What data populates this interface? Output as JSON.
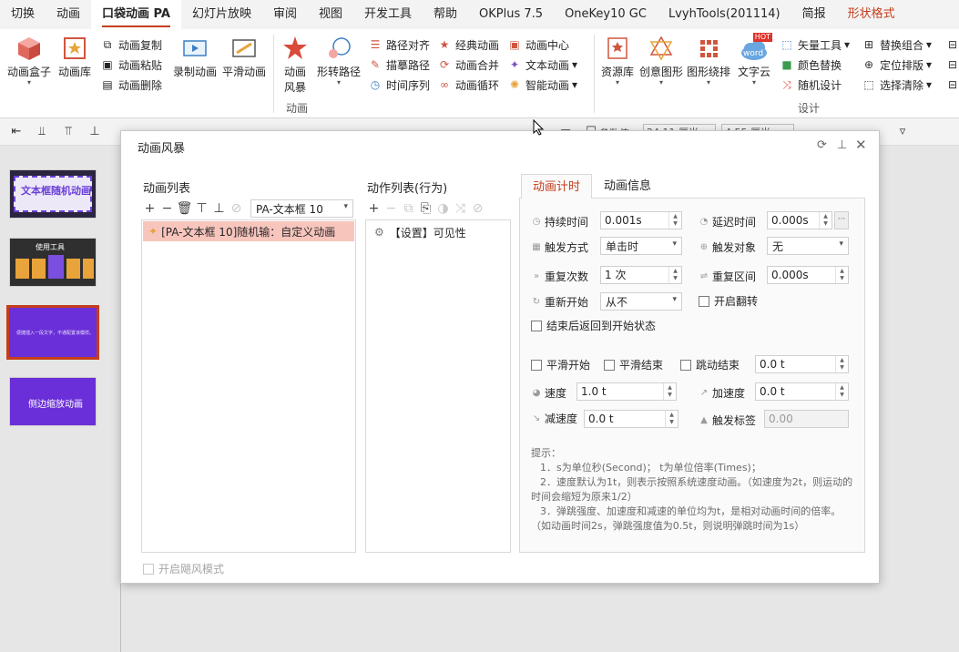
{
  "ribbon_tabs": [
    "切换",
    "动画",
    "口袋动画 PA",
    "幻灯片放映",
    "审阅",
    "视图",
    "开发工具",
    "帮助",
    "OKPlus 7.5",
    "OneKey10 GC",
    "LvyhTools(201114)",
    "简报",
    "形状格式"
  ],
  "ribbon": {
    "anim_box": "动画盒子",
    "anim_lib": "动画库",
    "anim_copy": "动画复制",
    "anim_paste": "动画粘贴",
    "anim_delete": "动画删除",
    "record_anim": "录制动画",
    "smooth_anim": "平滑动画",
    "anim_style_1": "动画",
    "anim_style_2": "风暴",
    "shape_path": "形转路径",
    "path_align": "路径对齐",
    "trace_path": "描摹路径",
    "time_sequence": "时间序列",
    "classic_anim": "经典动画",
    "anim_merge": "动画合并",
    "anim_loop": "动画循环",
    "anim_center": "动画中心",
    "text_anim": "文本动画",
    "smart_anim": "智能动画",
    "group_anim": "动画",
    "resource_lib": "资源库",
    "creative_shape": "创意图形",
    "shape_wrap": "图形绕排",
    "word_cloud": "文字云",
    "hot_badge": "HOT",
    "word_badge": "word",
    "vector_tool": "矢量工具",
    "color_replace": "颜色替换",
    "random_design": "随机设计",
    "replace_group": "替换组合",
    "position_layout": "定位排版",
    "select_clear": "选择清除",
    "group_design": "设计"
  },
  "quick_bar": {
    "partial_1": "参数值",
    "partial_2": "24.11 厘米",
    "partial_3": "4.55 厘米"
  },
  "slides": [
    {
      "title": "文本框随机动画"
    },
    {
      "title": "使用工具"
    },
    {
      "title": "便捷插入一段文字，不通配置该模样。"
    },
    {
      "title": "侧边缩放动画"
    }
  ],
  "dialog": {
    "title": "动画风暴",
    "anim_list_title": "动画列表",
    "anim_list_combo": "PA-文本框 10",
    "anim_list_item": "[PA-文本框 10]随机输：自定义动画",
    "action_list_title": "动作列表(行为)",
    "action_item": "【设置】可见性",
    "tab_timing": "动画计时",
    "tab_info": "动画信息",
    "fields": {
      "duration_label": "持续时间",
      "duration_value": "0.001s",
      "delay_label": "延迟时间",
      "delay_value": "0.000s",
      "trigger_label": "触发方式",
      "trigger_value": "单击时",
      "trigger_obj_label": "触发对象",
      "trigger_obj_value": "无",
      "repeat_label": "重复次数",
      "repeat_value": "1 次",
      "repeat_interval_label": "重复区间",
      "repeat_interval_value": "0.000s",
      "restart_label": "重新开始",
      "restart_value": "从不",
      "flip_label": "开启翻转",
      "return_label": "结束后返回到开始状态",
      "smooth_start": "平滑开始",
      "smooth_end": "平滑结束",
      "bounce_end": "跳动结束",
      "bounce_value": "0.0 t",
      "speed_label": "速度",
      "speed_value": "1.0 t",
      "accel_label": "加速度",
      "accel_value": "0.0 t",
      "decel_label": "减速度",
      "decel_value": "0.0 t",
      "trigger_bookmark_label": "触发标签",
      "trigger_bookmark_value": "0.00"
    },
    "tips": [
      "提示：",
      "1．s为单位秒(Second)； t为单位倍率(Times)；",
      "2．速度默认为1t，则表示按照系统速度动画。（如速度为2t，则运动的时间会缩短为原来1/2）",
      "3．弹跳强度、加速度和减速的单位均为t，是相对动画时间的倍率。（如动画时间2s，弹跳强度值为0.5t，则说明弹跳时间为1s）"
    ],
    "storm_mode": "开启飓风模式"
  }
}
